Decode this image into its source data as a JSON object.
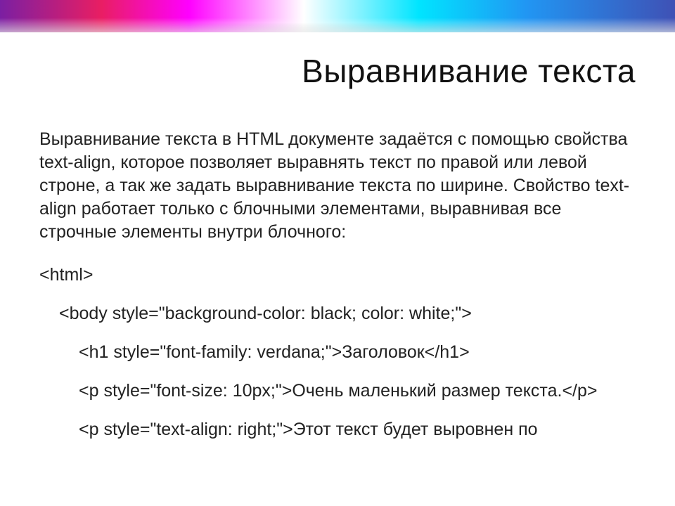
{
  "slide": {
    "title": "Выравнивание текста",
    "description": "Выравнивание текста в HTML документе задаётся с помощью свойства text-align, которое позволяет выравнять текст по правой или левой строне, а так же задать выравнивание текста по ширине. Свойство text-align работает только с блочными элементами, выравнивая все строчные элементы внутри блочного:",
    "code": {
      "line1": "<html>",
      "line2": "<body style=\"background-color: black; color: white;\">",
      "line3": "<h1 style=\"font-family: verdana;\">Заголовок</h1>",
      "line4": "<p style=\"font-size: 10px;\">Очень маленький размер текста.</p>",
      "line5": "<p style=\"text-align: right;\">Этот текст будет выровнен по"
    }
  }
}
